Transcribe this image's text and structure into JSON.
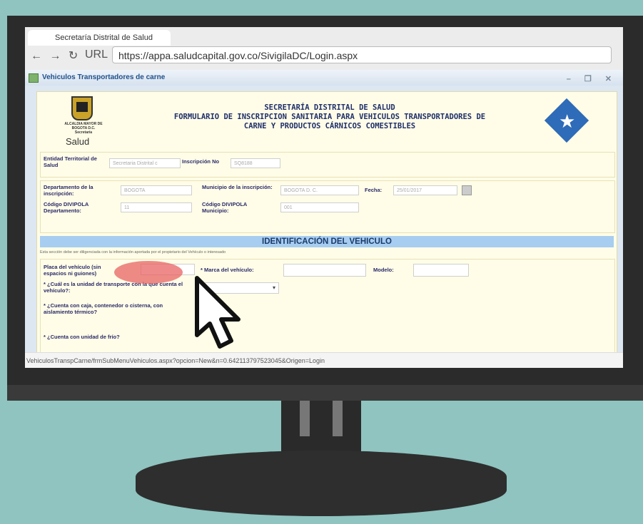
{
  "browser": {
    "tab_title": "Secretaría Distrital de Salud",
    "nav_icons": "← → ↻",
    "url_label": "URL",
    "url": "https://appa.saludcapital.gov.co/SivigilaDC/Login.aspx"
  },
  "app": {
    "window_title": "Vehiculos Transportadores de carne",
    "header": {
      "line1": "SECRETARÍA DISTRITAL DE SALUD",
      "line2": "FORMULARIO DE INSCRIPCION SANITARIA PARA VEHICULOS TRANSPORTADORES DE",
      "line3": "CARNE Y PRODUCTOS CÁRNICOS COMESTIBLES",
      "crest_text": "ALCALDIA MAYOR DE BOGOTA D.C.",
      "crest_sub": "Secretaría",
      "logo_text": "Salud"
    },
    "fields": {
      "entidad_label": "Entidad Territorial de Salud",
      "entidad_value": "Secretaria Distrital c",
      "inscripcion_label": "Inscripción No",
      "inscripcion_value": "SQ8188",
      "depto_label": "Departamento de la inscripción:",
      "depto_value": "BOGOTA",
      "municipio_label": "Municipio de la inscripción:",
      "municipio_value": "BOGOTA D. C.",
      "fecha_label": "Fecha:",
      "fecha_value": "25/01/2017",
      "cod_depto_label": "Código DIVIPOLA Departamento:",
      "cod_depto_value": "11",
      "cod_mun_label": "Código DIVIPOLA Municipio:",
      "cod_mun_value": "001"
    },
    "section_title": "IDENTIFICACIÓN DEL VEHICULO",
    "section_note": "Esta sección debe ser diligenciada con la información aportada por el propietario del Vehículo o interesado",
    "vehicle": {
      "placa_label": "Placa del vehículo (sin espacios ni guiones)",
      "marca_label": "* Marca del vehículo:",
      "modelo_label": "Modelo:",
      "unidad_label": "* ¿Cuál es la unidad de transporte con la que cuenta el vehículo?:",
      "caja_label": "* ¿Cuenta con caja, contenedor o cisterna, con aislamiento térmico?",
      "frio_label": "* ¿Cuenta con unidad de frío?"
    },
    "status_url": "VehiculosTranspCarne/frmSubMenuVehiculos.aspx?opcion=New&n=0.642113797523045&Origen=Login"
  }
}
